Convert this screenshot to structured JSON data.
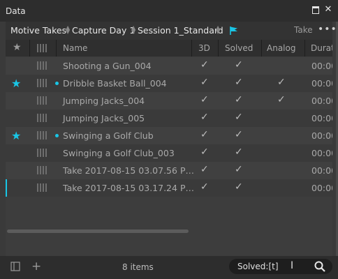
{
  "window": {
    "title": "Data"
  },
  "breadcrumb": {
    "items": [
      "Motive Takes",
      "Capture Day 1",
      "Session 1_Standard"
    ],
    "take_label": "Take",
    "more_label": "•••"
  },
  "columns": {
    "name": "Name",
    "threed": "3D",
    "solved": "Solved",
    "analog": "Analog",
    "duration": "Durat"
  },
  "check_glyph": "✓",
  "rows": [
    {
      "name": "Shooting a Gun_004",
      "duration": "00:00",
      "starred": false,
      "dot": false,
      "threed": true,
      "solved": true,
      "analog": false
    },
    {
      "name": "Dribble Basket Ball_004",
      "duration": "00:00",
      "starred": true,
      "dot": true,
      "threed": true,
      "solved": true,
      "analog": true
    },
    {
      "name": "Jumping Jacks_004",
      "duration": "00:00",
      "starred": false,
      "dot": false,
      "threed": true,
      "solved": true,
      "analog": true
    },
    {
      "name": "Jumping Jacks_005",
      "duration": "00:00",
      "starred": false,
      "dot": false,
      "threed": true,
      "solved": true,
      "analog": false
    },
    {
      "name": "Swinging a Golf Club",
      "duration": "00:00",
      "starred": true,
      "dot": true,
      "threed": true,
      "solved": true,
      "analog": false
    },
    {
      "name": "Swinging a Golf Club_003",
      "duration": "00:00",
      "starred": false,
      "dot": false,
      "threed": true,
      "solved": true,
      "analog": false
    },
    {
      "name": "Take 2017-08-15 03.07.56 P…",
      "duration": "00:00",
      "starred": false,
      "dot": false,
      "threed": true,
      "solved": true,
      "analog": false
    },
    {
      "name": "Take 2017-08-15 03.17.24 P…",
      "duration": "00:00",
      "starred": false,
      "dot": false,
      "threed": true,
      "solved": true,
      "analog": false
    }
  ],
  "footer": {
    "count_text": "8 items",
    "search_value": "Solved:[t]"
  },
  "colors": {
    "accent": "#19c6e6",
    "panel": "#3a3a3a",
    "header": "#2f2f2f"
  },
  "icons": {
    "star": "star-icon",
    "takes": "takes-bars-icon",
    "flag": "flag-icon",
    "search": "search-icon",
    "add": "plus-icon",
    "panel": "panel-toggle-icon"
  }
}
